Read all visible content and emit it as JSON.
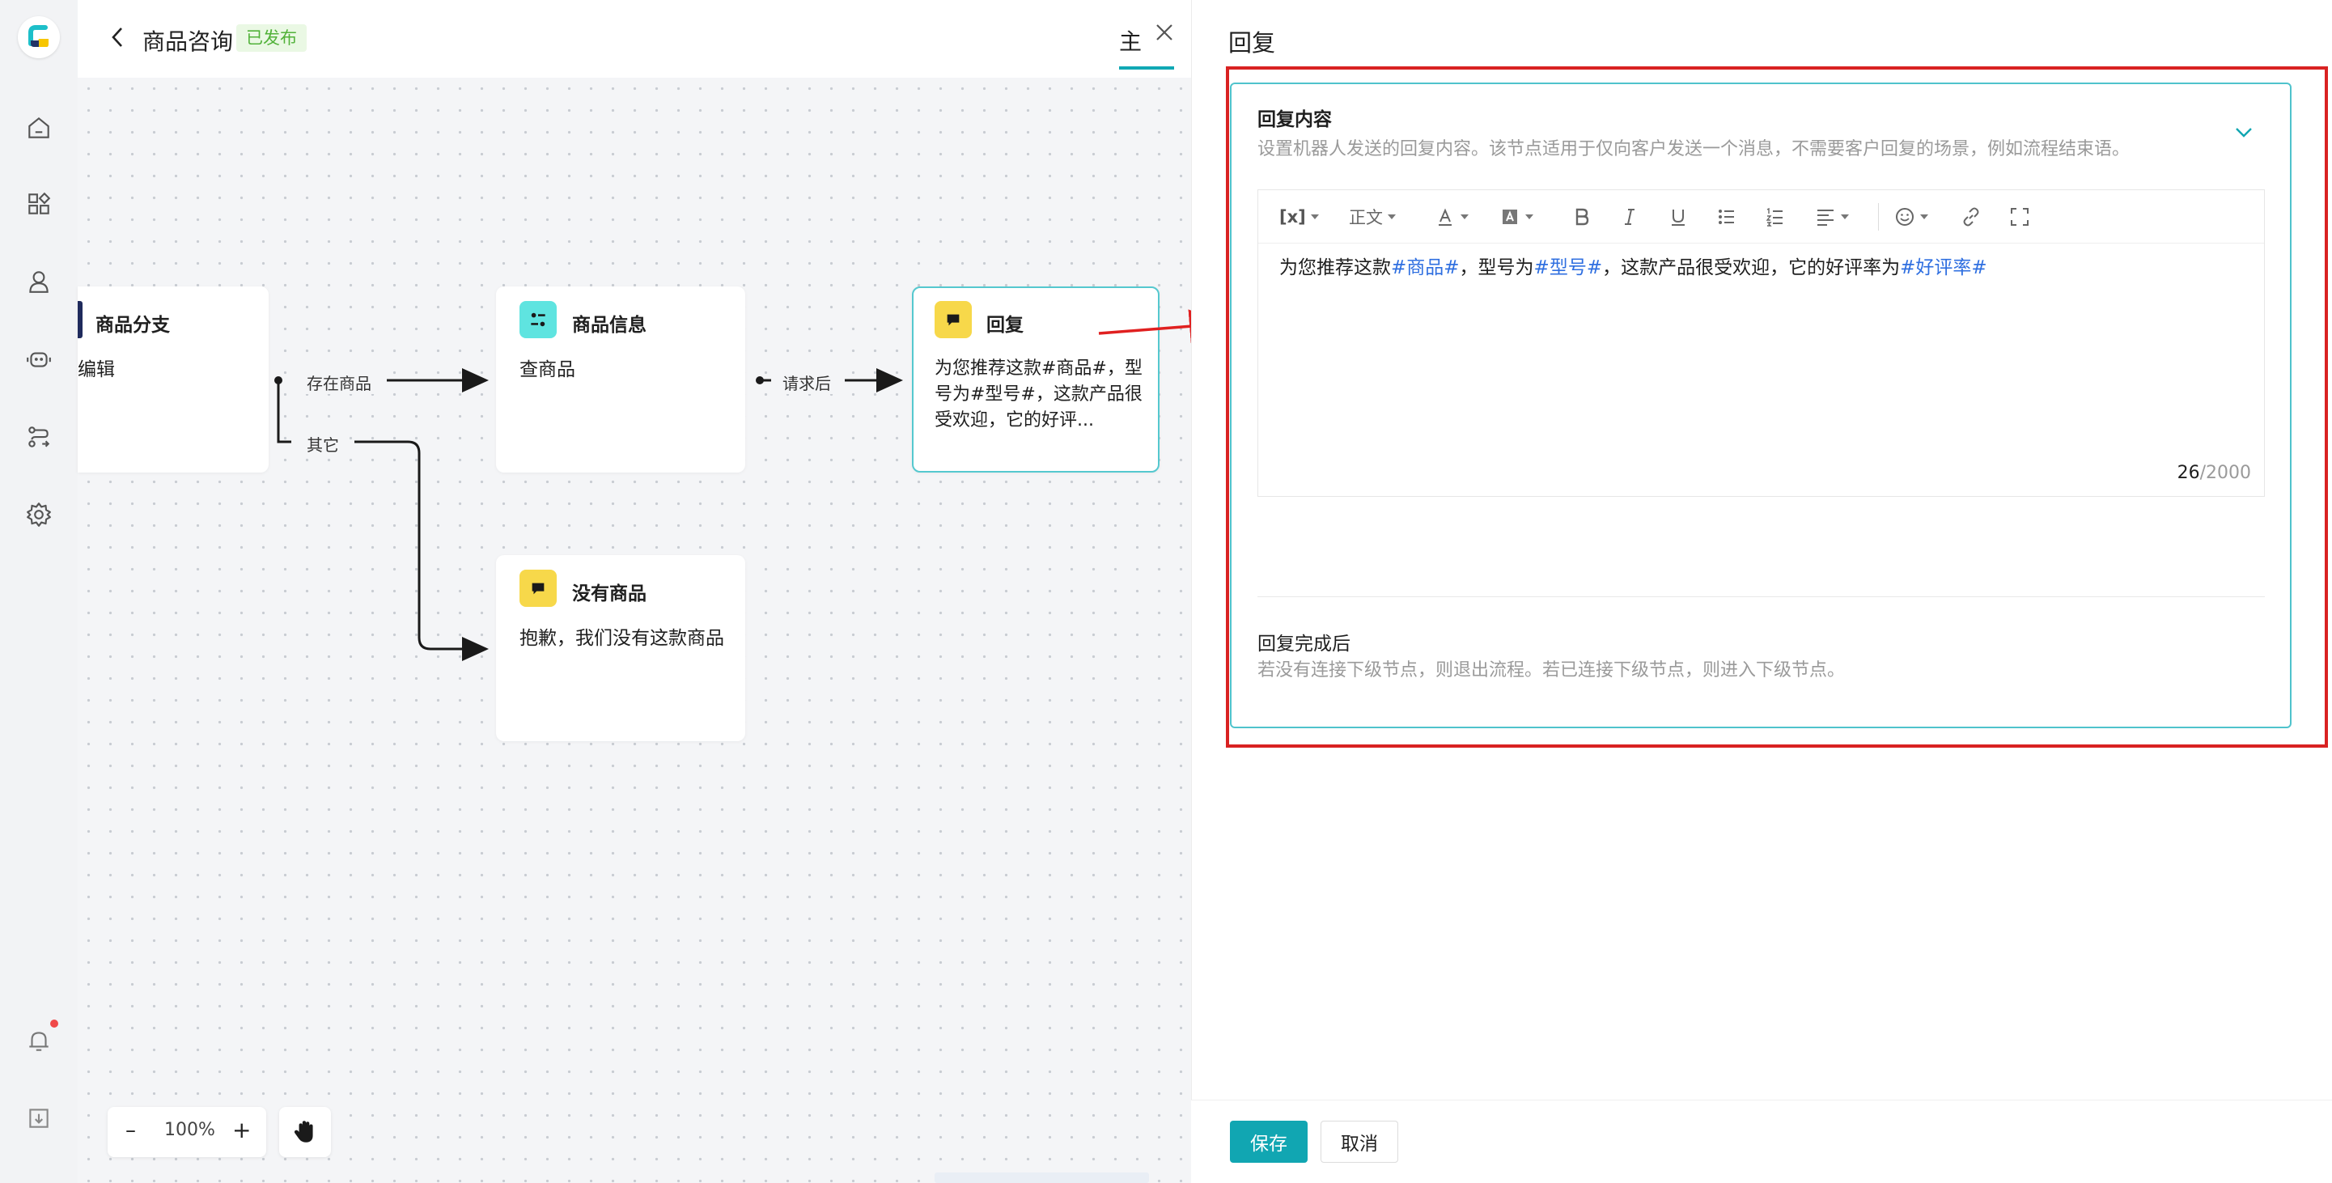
{
  "sidebar": {
    "items": [
      {
        "icon": "home-icon"
      },
      {
        "icon": "apps-icon"
      },
      {
        "icon": "user-icon"
      },
      {
        "icon": "robot-icon"
      },
      {
        "icon": "flow-icon"
      },
      {
        "icon": "gear-icon"
      }
    ],
    "bottom": [
      {
        "icon": "bell-icon"
      },
      {
        "icon": "download-icon"
      }
    ]
  },
  "header": {
    "title": "商品咨询",
    "badge": "已发布",
    "tab": "主"
  },
  "canvas": {
    "nodes": {
      "branch": {
        "title": "商品分支",
        "body": "编辑"
      },
      "info": {
        "title": "商品信息",
        "body": "查商品"
      },
      "reply": {
        "title": "回复",
        "body": "为您推荐这款#商品#，型号为#型号#，这款产品很受欢迎，它的好评..."
      },
      "none": {
        "title": "没有商品",
        "body": "抱歉，我们没有这款商品"
      }
    },
    "edges": {
      "exists": "存在商品",
      "other": "其它",
      "after_request": "请求后"
    },
    "zoom": {
      "minus": "–",
      "level": "100%",
      "plus": "+"
    }
  },
  "panel": {
    "title": "回复",
    "content_section": {
      "title": "回复内容",
      "desc": "设置机器人发送的回复内容。该节点适用于仅向客户发送一个消息，不需要客户回复的场景，例如流程结束语。"
    },
    "toolbar": {
      "variable": "[x]",
      "paragraph": "正文"
    },
    "editor": {
      "seg1": "为您推荐这款",
      "var1": "#商品#",
      "seg2": "，型号为",
      "var2": "#型号#",
      "seg3": "，这款产品很受欢迎，它的好评率为",
      "var3": "#好评率#",
      "count": "26",
      "max": "/2000"
    },
    "after_section": {
      "title": "回复完成后",
      "desc": "若没有连接下级节点，则退出流程。若已连接下级节点，则进入下级节点。"
    }
  },
  "footer": {
    "save": "保存",
    "cancel": "取消"
  },
  "colors": {
    "accent": "#11a6b2",
    "highlight": "#d92222",
    "variable": "#2f6fe0",
    "badge": "#52b23a"
  }
}
